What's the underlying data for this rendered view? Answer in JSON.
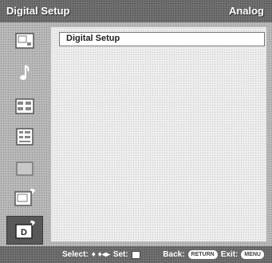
{
  "header": {
    "title": "Digital Setup",
    "mode": "Analog"
  },
  "sidebar": {
    "items": [
      {
        "icon": "picture-icon",
        "selected": false
      },
      {
        "icon": "music-note-icon",
        "selected": false
      },
      {
        "icon": "channel-icon",
        "selected": false
      },
      {
        "icon": "parental-lock-icon",
        "selected": false
      },
      {
        "icon": "blank-screen-icon",
        "selected": false
      },
      {
        "icon": "setup-icon",
        "selected": false
      },
      {
        "icon": "digital-setup-icon",
        "selected": true
      }
    ]
  },
  "content": {
    "title": "Digital Setup"
  },
  "footer": {
    "select_label": "Select:",
    "select_arrows": "♦ ♦◂▸",
    "set_label": "Set:",
    "back_label": "Back:",
    "back_key": "RETURN",
    "exit_label": "Exit:",
    "exit_key": "MENU"
  },
  "colors": {
    "header_bg": "#6f6f6f",
    "panel_bg": "#b9b9b9",
    "content_bg": "#ededed",
    "selected_bg": "#585858"
  }
}
